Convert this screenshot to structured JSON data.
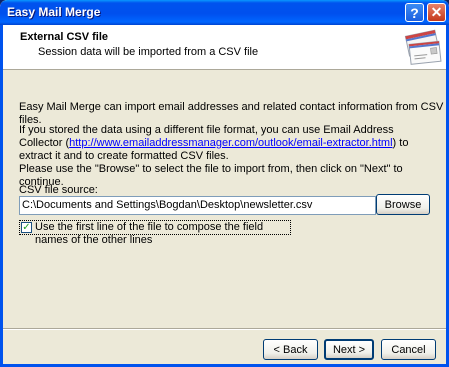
{
  "window": {
    "title": "Easy Mail Merge"
  },
  "titlebar": {
    "help_label": "?",
    "close_label": "✕"
  },
  "header": {
    "title": "External CSV file",
    "subtitle": "Session data will be imported from a CSV file"
  },
  "body": {
    "para1": "Easy Mail Merge can import email addresses and related contact information from CSV files.",
    "para2_before": "If you stored the data using a different file format, you can use Email Address Collector (",
    "para2_link": "http://www.emailaddressmanager.com/outlook/email-extractor.html",
    "para2_after": ") to extract it and to create formatted CSV files.",
    "para3": "Please use the \"Browse\" to select the file to import from, then click on \"Next\" to continue."
  },
  "csv": {
    "label": "CSV file source:",
    "value": "C:\\Documents and Settings\\Bogdan\\Desktop\\newsletter.csv",
    "browse_label": "Browse",
    "use_first_line_label": "Use the first line of the file to compose the field names of the other lines",
    "use_first_line_checked": true
  },
  "footer": {
    "back_label": "< Back",
    "next_label": "Next >",
    "cancel_label": "Cancel"
  }
}
